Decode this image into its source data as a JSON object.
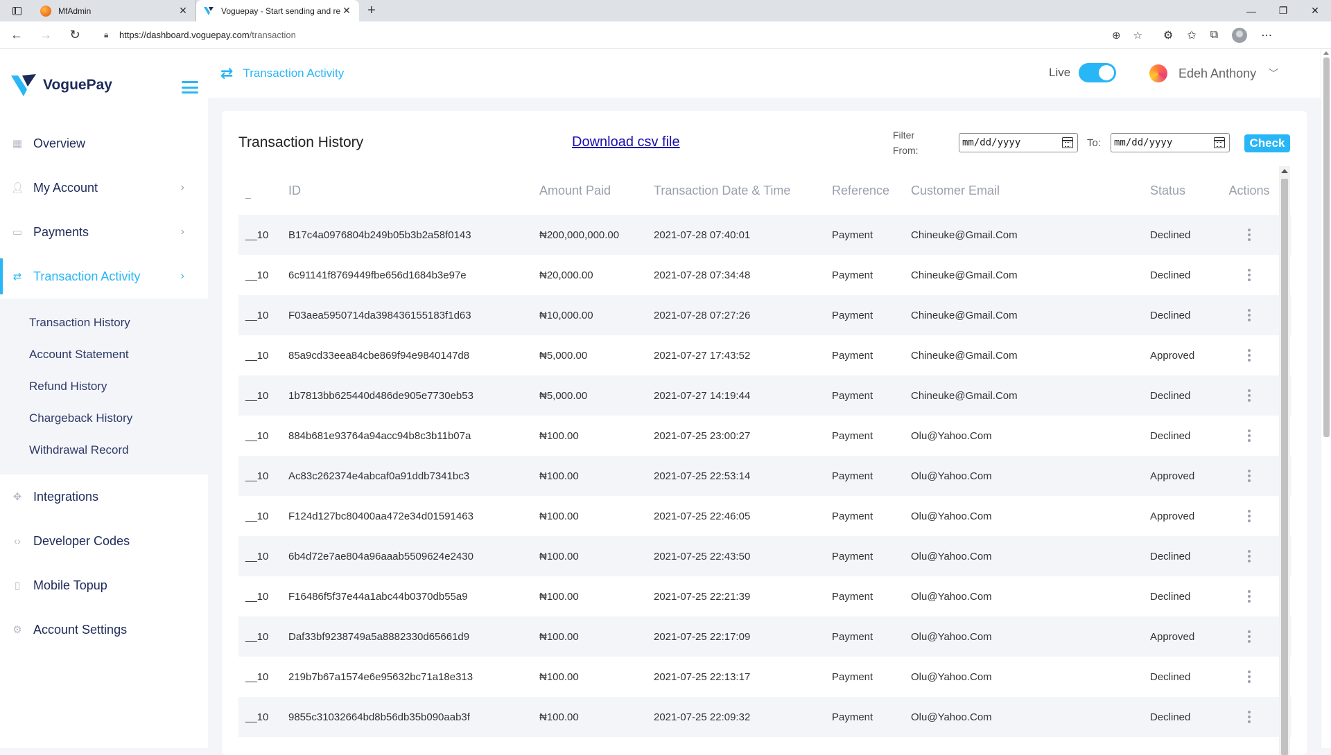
{
  "browser": {
    "tabs": [
      {
        "title": "MfAdmin",
        "active": false
      },
      {
        "title": "Voguepay - Start sending and re",
        "active": true
      }
    ],
    "url_host": "https://dashboard.voguepay.com",
    "url_path": "/transaction"
  },
  "sidebar": {
    "brand": "VoguePay",
    "items": [
      {
        "label": "Overview",
        "icon": "grid-icon",
        "has_chevron": false
      },
      {
        "label": "My Account",
        "icon": "user-icon",
        "has_chevron": true
      },
      {
        "label": "Payments",
        "icon": "card-icon",
        "has_chevron": true
      },
      {
        "label": "Transaction Activity",
        "icon": "swap-icon",
        "has_chevron": true,
        "active": true
      }
    ],
    "subitems": [
      "Transaction History",
      "Account Statement",
      "Refund History",
      "Chargeback History",
      "Withdrawal Record"
    ],
    "items_after": [
      {
        "label": "Integrations",
        "icon": "puzzle-icon"
      },
      {
        "label": "Developer Codes",
        "icon": "code-icon"
      },
      {
        "label": "Mobile Topup",
        "icon": "phone-icon"
      },
      {
        "label": "Account Settings",
        "icon": "gear-icon"
      }
    ]
  },
  "topbar": {
    "title": "Transaction Activity",
    "live_label": "Live",
    "live_on": true,
    "user_name": "Edeh Anthony"
  },
  "card": {
    "title": "Transaction History",
    "download_label": "Download csv file",
    "filter_label": "Filter From:",
    "from_placeholder": "mm/dd/yyyy",
    "to_label": "To:",
    "to_placeholder": "mm/dd/yyyy",
    "check_label": "Check"
  },
  "table": {
    "columns": [
      "_",
      "ID",
      "Amount Paid",
      "Transaction Date & Time",
      "Reference",
      "Customer Email",
      "Status",
      "Actions"
    ],
    "rows": [
      {
        "n": "__10",
        "id": "B17c4a0976804b249b05b3b2a58f0143",
        "amount": "₦200,000,000.00",
        "date": "2021-07-28 07:40:01",
        "ref": "Payment",
        "email": "Chineuke@Gmail.Com",
        "status": "Declined"
      },
      {
        "n": "__10",
        "id": "6c91141f8769449fbe656d1684b3e97e",
        "amount": "₦20,000.00",
        "date": "2021-07-28 07:34:48",
        "ref": "Payment",
        "email": "Chineuke@Gmail.Com",
        "status": "Declined"
      },
      {
        "n": "__10",
        "id": "F03aea5950714da398436155183f1d63",
        "amount": "₦10,000.00",
        "date": "2021-07-28 07:27:26",
        "ref": "Payment",
        "email": "Chineuke@Gmail.Com",
        "status": "Declined"
      },
      {
        "n": "__10",
        "id": "85a9cd33eea84cbe869f94e9840147d8",
        "amount": "₦5,000.00",
        "date": "2021-07-27 17:43:52",
        "ref": "Payment",
        "email": "Chineuke@Gmail.Com",
        "status": "Approved"
      },
      {
        "n": "__10",
        "id": "1b7813bb625440d486de905e7730eb53",
        "amount": "₦5,000.00",
        "date": "2021-07-27 14:19:44",
        "ref": "Payment",
        "email": "Chineuke@Gmail.Com",
        "status": "Declined"
      },
      {
        "n": "__10",
        "id": "884b681e93764a94acc94b8c3b11b07a",
        "amount": "₦100.00",
        "date": "2021-07-25 23:00:27",
        "ref": "Payment",
        "email": "Olu@Yahoo.Com",
        "status": "Declined"
      },
      {
        "n": "__10",
        "id": "Ac83c262374e4abcaf0a91ddb7341bc3",
        "amount": "₦100.00",
        "date": "2021-07-25 22:53:14",
        "ref": "Payment",
        "email": "Olu@Yahoo.Com",
        "status": "Approved"
      },
      {
        "n": "__10",
        "id": "F124d127bc80400aa472e34d01591463",
        "amount": "₦100.00",
        "date": "2021-07-25 22:46:05",
        "ref": "Payment",
        "email": "Olu@Yahoo.Com",
        "status": "Approved"
      },
      {
        "n": "__10",
        "id": "6b4d72e7ae804a96aaab5509624e2430",
        "amount": "₦100.00",
        "date": "2021-07-25 22:43:50",
        "ref": "Payment",
        "email": "Olu@Yahoo.Com",
        "status": "Declined"
      },
      {
        "n": "__10",
        "id": "F16486f5f37e44a1abc44b0370db55a9",
        "amount": "₦100.00",
        "date": "2021-07-25 22:21:39",
        "ref": "Payment",
        "email": "Olu@Yahoo.Com",
        "status": "Declined"
      },
      {
        "n": "__10",
        "id": "Daf33bf9238749a5a8882330d65661d9",
        "amount": "₦100.00",
        "date": "2021-07-25 22:17:09",
        "ref": "Payment",
        "email": "Olu@Yahoo.Com",
        "status": "Approved"
      },
      {
        "n": "__10",
        "id": "219b7b67a1574e6e95632bc71a18e313",
        "amount": "₦100.00",
        "date": "2021-07-25 22:13:17",
        "ref": "Payment",
        "email": "Olu@Yahoo.Com",
        "status": "Declined"
      },
      {
        "n": "__10",
        "id": "9855c31032664bd8b56db35b090aab3f",
        "amount": "₦100.00",
        "date": "2021-07-25 22:09:32",
        "ref": "Payment",
        "email": "Olu@Yahoo.Com",
        "status": "Declined"
      }
    ]
  },
  "colors": {
    "accent": "#29b6f6",
    "brand_dark": "#1d2a5a",
    "stripe": "#f4f5f9"
  }
}
